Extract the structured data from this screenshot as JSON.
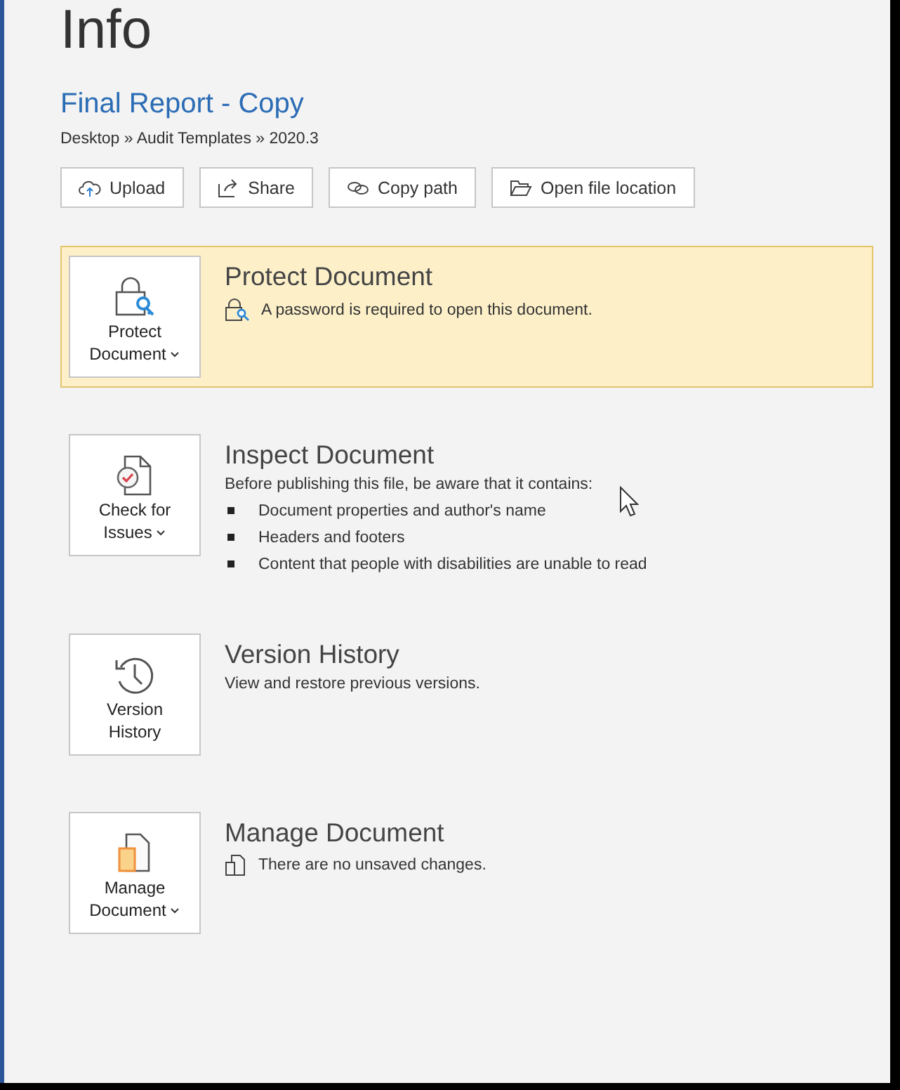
{
  "page_title": "Info",
  "document": {
    "name": "Final Report - Copy",
    "path": "Desktop » Audit Templates » 2020.3"
  },
  "actions": [
    {
      "label": "Upload",
      "kind": "upload"
    },
    {
      "label": "Share",
      "kind": "share"
    },
    {
      "label": "Copy path",
      "kind": "link"
    },
    {
      "label": "Open file location",
      "kind": "folder"
    }
  ],
  "sections": [
    {
      "kind": "protect",
      "highlighted": true,
      "button": {
        "label": "Protect Document",
        "dropdown": true
      },
      "heading": "Protect Document",
      "detail": {
        "text": "A password is required to open this document."
      }
    },
    {
      "kind": "inspect",
      "highlighted": false,
      "button": {
        "label": "Check for Issues",
        "dropdown": true
      },
      "heading": "Inspect Document",
      "intro": "Before publishing this file, be aware that it contains:",
      "bullets": [
        "Document properties and author's name",
        "Headers and footers",
        "Content that people with disabilities are unable to read"
      ]
    },
    {
      "kind": "history",
      "highlighted": false,
      "button": {
        "label": "Version History",
        "dropdown": false
      },
      "heading": "Version History",
      "intro": "View and restore previous versions."
    },
    {
      "kind": "manage",
      "highlighted": false,
      "button": {
        "label": "Manage Document",
        "dropdown": true
      },
      "heading": "Manage Document",
      "detail": {
        "text": "There are no unsaved changes."
      }
    }
  ]
}
